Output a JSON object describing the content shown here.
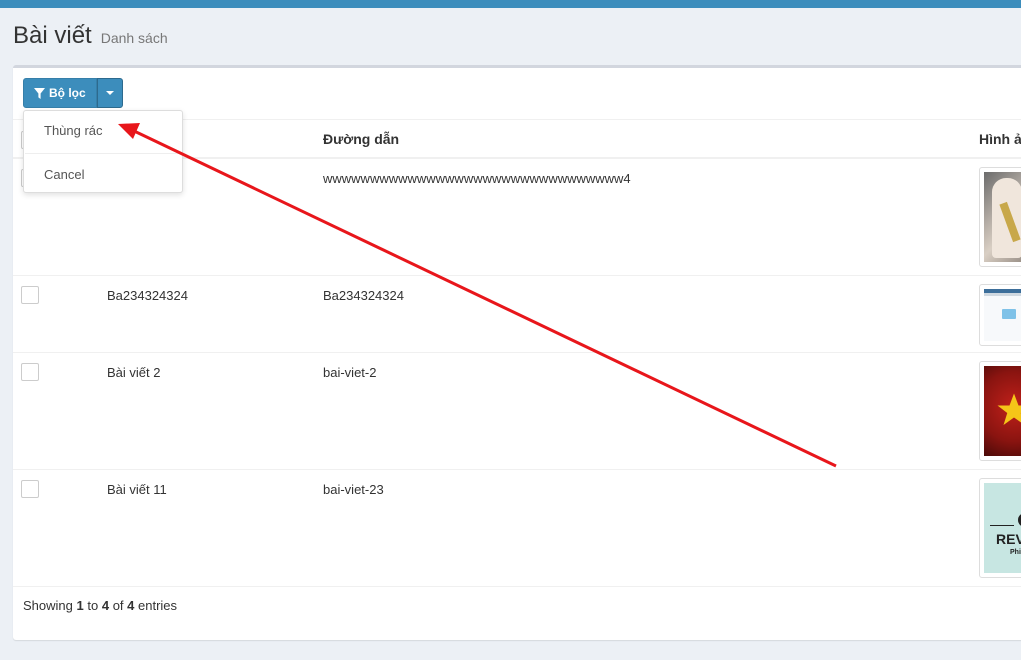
{
  "header": {
    "title": "Bài viết",
    "subtitle": "Danh sách"
  },
  "toolbar": {
    "filter_label": "Bộ lọc"
  },
  "dropdown": {
    "items": [
      "Thùng rác",
      "Cancel"
    ]
  },
  "table": {
    "columns": [
      "Đường dẫn",
      "Hình ả"
    ],
    "rows": [
      {
        "title": "",
        "slug": "wwwwwwwwwwwwwwwwwwwwwwwwwwwwwwww4"
      },
      {
        "title": "Ba234324324",
        "slug": "Ba234324324"
      },
      {
        "title": "Bài viết 2",
        "slug": "bai-viet-2"
      },
      {
        "title": "Bài viết 11",
        "slug": "bai-viet-23"
      }
    ]
  },
  "thumbnails": {
    "review_text": "REV",
    "review_sub": "Phi"
  },
  "pagination": {
    "prefix": "Showing",
    "from": "1",
    "to_word": "to",
    "to": "4",
    "of_word": "of",
    "total": "4",
    "suffix": "entries"
  },
  "colors": {
    "primary": "#3c8dbc",
    "annotation_arrow": "#e8161b"
  }
}
